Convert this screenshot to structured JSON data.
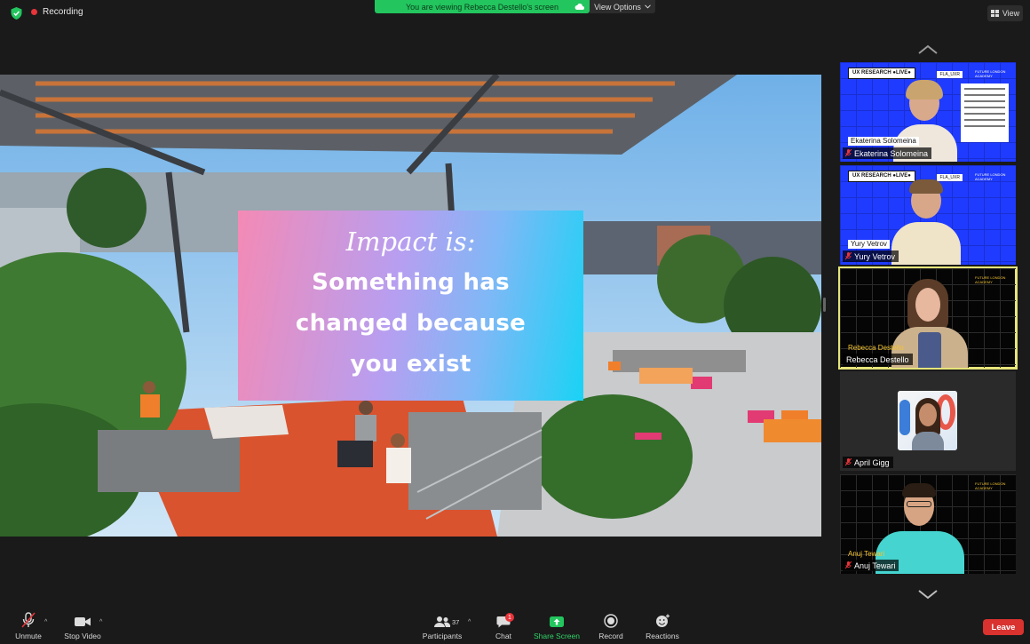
{
  "recording": {
    "label": "Recording"
  },
  "banner": {
    "viewing_text": "You are viewing Rebecca Destello's screen",
    "view_options_label": "View Options"
  },
  "view_button": {
    "label": "View"
  },
  "slide": {
    "line1": "Impact is:",
    "line2": "Something has",
    "line3": "changed because",
    "line4": "you exist"
  },
  "participants_gallery": [
    {
      "name": "Ekaterina Solomeina",
      "muted": true,
      "bg": "blue",
      "slide_label": "Ekaterina Solomeina",
      "badge": "UX RESEARCH ●LIVE●"
    },
    {
      "name": "Yury Vetrov",
      "muted": true,
      "bg": "blue",
      "slide_label": "Yury Vetrov",
      "badge": "UX RESEARCH ●LIVE●"
    },
    {
      "name": "Rebecca Destello",
      "muted": false,
      "bg": "black",
      "slide_label": "Rebecca Destello",
      "active_speaker": true
    },
    {
      "name": "April Gigg",
      "muted": true,
      "bg": "grey"
    },
    {
      "name": "Anuj Tewari",
      "muted": true,
      "bg": "black",
      "slide_label": "Anuj Tewari"
    }
  ],
  "toolbar": {
    "unmute": "Unmute",
    "stop_video": "Stop Video",
    "participants": "Participants",
    "participant_count": "37",
    "chat": "Chat",
    "chat_badge": "1",
    "share_screen": "Share Screen",
    "record": "Record",
    "reactions": "Reactions",
    "leave": "Leave"
  },
  "colors": {
    "accent_green": "#23c55e",
    "leave_red": "#d9322f",
    "active_outline": "#e6e57a",
    "slide_blue": "#1f3bff"
  }
}
